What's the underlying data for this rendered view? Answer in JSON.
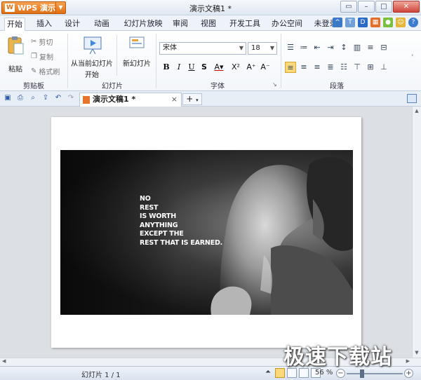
{
  "app": {
    "button_label": "WPS 演示",
    "document_title": "演示文稿1 *"
  },
  "menu_tabs": [
    "开始",
    "插入",
    "设计",
    "动画",
    "幻灯片放映",
    "审阅",
    "视图",
    "开发工具",
    "办公空间",
    "未登录"
  ],
  "ribbon": {
    "clipboard": {
      "paste": "粘贴",
      "cut": "剪切",
      "copy": "复制",
      "format_painter": "格式刷",
      "group_label": "剪贴板"
    },
    "slides": {
      "from_current": "从当前幻灯片",
      "from_current_sub": "开始",
      "new_slide": "新幻灯片",
      "group_label": "幻灯片"
    },
    "font": {
      "name": "宋体",
      "size": "18",
      "group_label": "字体"
    },
    "paragraph": {
      "group_label": "段落"
    }
  },
  "document_tab": {
    "label": "演示文稿1 *"
  },
  "slide": {
    "quote_lines": [
      "NO",
      "REST",
      "IS WORTH",
      "ANYTHING",
      "EXCEPT THE",
      "REST THAT IS EARNED."
    ]
  },
  "status": {
    "slide_count": "幻灯片 1 / 1",
    "zoom": "56 %",
    "zoom_fraction": 0.56
  },
  "watermark": "极速下载站"
}
